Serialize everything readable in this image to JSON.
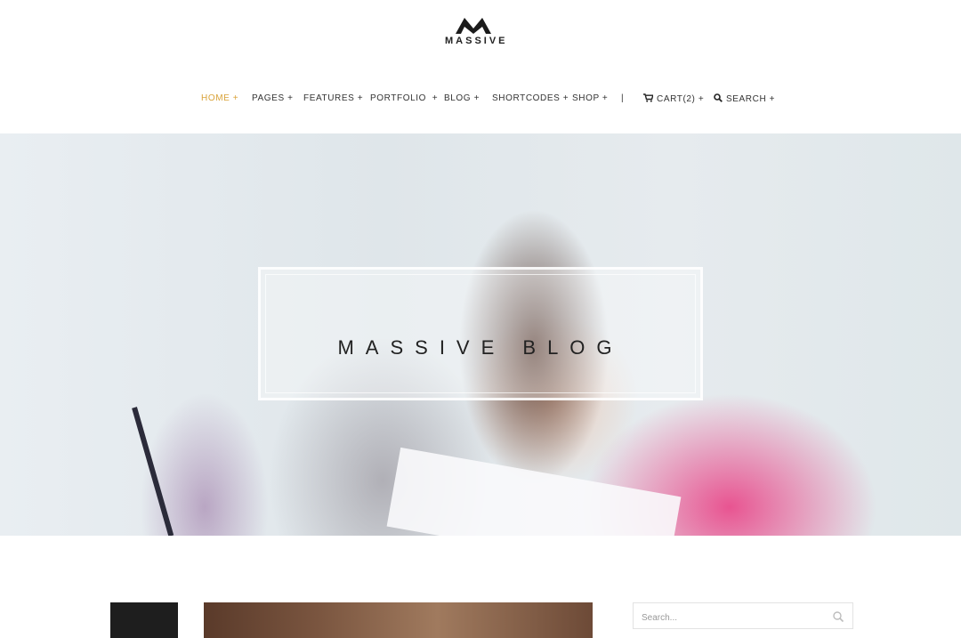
{
  "brand": {
    "name": "MASSIVE",
    "icon": "massive-logo-mark"
  },
  "nav": {
    "items": [
      {
        "label": "HOME +",
        "active": true
      },
      {
        "label": "PAGES +"
      },
      {
        "label": "FEATURES +"
      },
      {
        "label": "PORTFOLIO  +"
      },
      {
        "label": "BLOG +"
      },
      {
        "label": "SHORTCODES +"
      },
      {
        "label": "SHOP +"
      }
    ],
    "separator": "|",
    "cart": {
      "label": "CART(2) +",
      "icon": "cart-icon"
    },
    "search": {
      "label": "SEARCH +",
      "icon": "search-icon"
    }
  },
  "hero": {
    "title": "MASSIVE BLOG"
  },
  "sidebar": {
    "search": {
      "placeholder": "Search...",
      "icon": "search-icon"
    }
  },
  "colors": {
    "accent": "#d9a33a",
    "text": "#333333",
    "dark": "#1e1e1e"
  }
}
